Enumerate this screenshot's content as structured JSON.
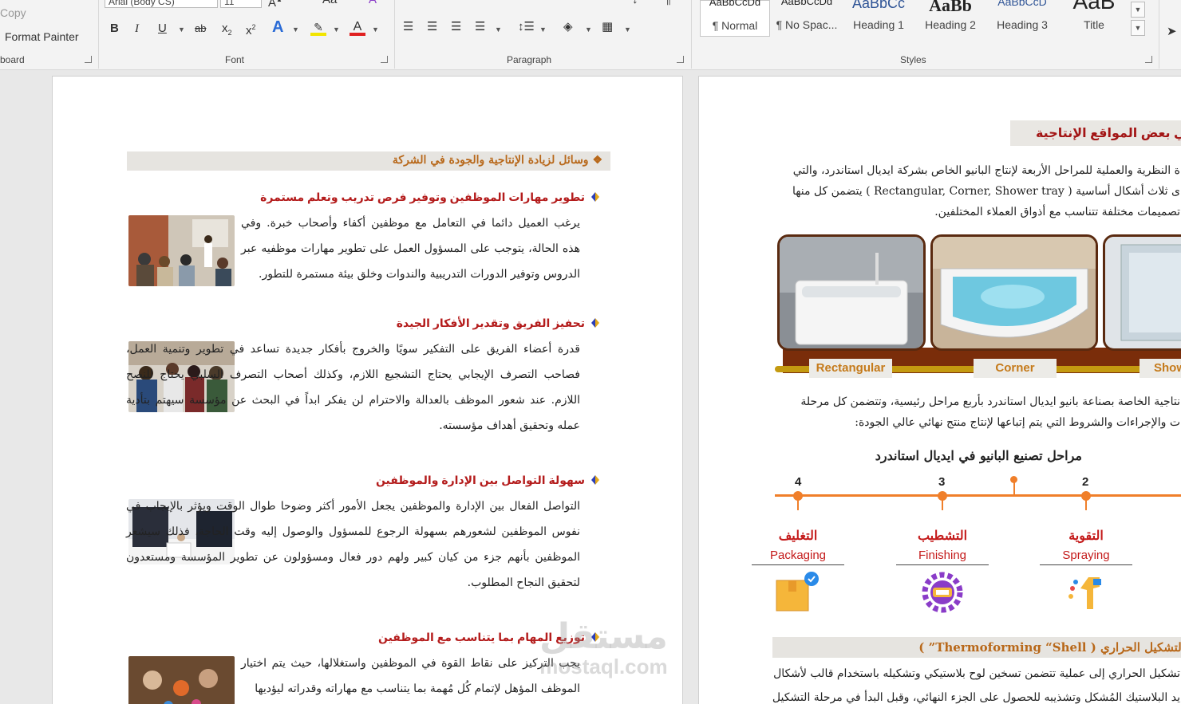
{
  "ribbon": {
    "clipboard": {
      "copy": "Copy",
      "format_painter": "Format Painter",
      "group": "board"
    },
    "font": {
      "family": "Arial (Body CS)",
      "size": "11",
      "group": "Font"
    },
    "paragraph": {
      "group": "Paragraph"
    },
    "styles": {
      "group": "Styles",
      "items": [
        {
          "preview": "AaBbCcDd",
          "name": "¶ Normal"
        },
        {
          "preview": "AaBbCcDd",
          "name": "¶ No Spac..."
        },
        {
          "preview": "AaBbCc",
          "name": "Heading 1"
        },
        {
          "preview": "AaBb",
          "name": "Heading 2"
        },
        {
          "preview": "AaBbCcD",
          "name": "Heading 3"
        },
        {
          "preview": "AaB",
          "name": "Title"
        }
      ]
    }
  },
  "colors": {
    "accent_orange": "#f07f2a",
    "heading_red": "#b41c1c",
    "section_orange": "#b8681a",
    "brown_band": "#7a2d0a"
  },
  "left_page": {
    "section_title": "وسائل لزيادة الإنتاجية والجودة في الشركة",
    "items": [
      {
        "heading": "تطوير مهارات الموظفين وتوفير فرص تدريب وتعلم مستمرة",
        "text": "يرغب العميل دائما في التعامل مع موظفين أكفاء وأصحاب خبرة. وفي هذه الحالة، يتوجب على المسؤول العمل على تطوير مهارات موظفيه عبر الدروس وتوفير الدورات التدريبية والندوات وخلق بيئة مستمرة للتطور."
      },
      {
        "heading": "تحفيز الفريق وتقدير الأفكار الجيدة",
        "text": "قدرة أعضاء الفريق على التفكير سويًا والخروج بأفكار جديدة تساعد في تطوير وتنمية العمل، فصاحب التصرف الإيجابي يحتاج التشجيع اللازم، وكذلك أصحاب التصرف السلبي يحتاج للنصح اللازم. عند شعور الموظف بالعدالة والاحترام لن يفكر ابداً في البحث عن مؤسسة سيهتم بتأدية عمله وتحقيق أهداف مؤسسته."
      },
      {
        "heading": "سهولة التواصل بين الإدارة والموظفين",
        "text": "التواصل الفعال بين الإدارة والموظفين يجعل الأمور أكثر وضوحا طوال الوقت ويؤثر بالإيجاب في نفوس الموظفين لشعورهم بسهولة الرجوع للمسؤول والوصول إليه وقت الحاجة، فذلك سيشعر الموظفين بأنهم جزء من كيان كبير ولهم دور فعال ومسؤولون عن تطوير المؤسسة ومستعدون لتحقيق النجاح المطلوب."
      },
      {
        "heading": "توزيع المهام بما يتناسب مع الموظفين",
        "text": "يجب التركيز على نقاط القوة في الموظفين واستغلالها، حيث يتم اختيار الموظف المؤهل لإتمام كُل مُهمة بما يتناسب مع مهاراته وقدراته ليؤديها"
      }
    ]
  },
  "right_page": {
    "title": "ل في بعض المواقع الإنتاجية",
    "intro": [
      "ة النظرية والعملية للمراحل الأربعة لإنتاج البانيو الخاص بشركة ايديال استاندرد، والتي",
      "ى ثلاث أشكال أساسية ( Rectangular, Corner, Shower tray ) يتضمن كل منها",
      "تصميمات مختلفة تتناسب مع أذواق العملاء المختلفين."
    ],
    "products": [
      {
        "label": "Rectangular"
      },
      {
        "label": "Corner"
      },
      {
        "label": "Showe"
      }
    ],
    "stages_intro": [
      "نتاجية الخاصة بصناعة بانيو ايديال استاندرد بأربع مراحل رئيسية، وتتضمن كل مرحلة",
      "ت والإجراءات والشروط التي يتم إتباعها لإنتاج منتج نهائي عالي الجودة:"
    ],
    "timeline": {
      "title": "مراحل تصنيع البانيو في ايديال استاندرد",
      "steps": [
        {
          "num": "4",
          "ar": "التغليف",
          "en": "Packaging",
          "icon": "package-icon"
        },
        {
          "num": "3",
          "ar": "التشطيب",
          "en": "Finishing",
          "icon": "gear-icon"
        },
        {
          "num": "2",
          "ar": "التقوية",
          "en": "Spraying",
          "icon": "spray-gun-icon"
        }
      ]
    },
    "section2": {
      "title": "ة التشكيل الحراري ( Thermoforming “Shell” )",
      "lines": [
        "تشكيل الحراري إلى عملية تتضمن تسخين لوح بلاستيكي وتشكيله باستخدام قالب لأشكال",
        "يد البلاستيك المُشكل وتشذيبه للحصول على الجزء النهائي، وقبل البدأ في مرحلة التشكيل"
      ]
    }
  },
  "watermark": {
    "ar": "مستقل",
    "en": "mostaql.com"
  }
}
